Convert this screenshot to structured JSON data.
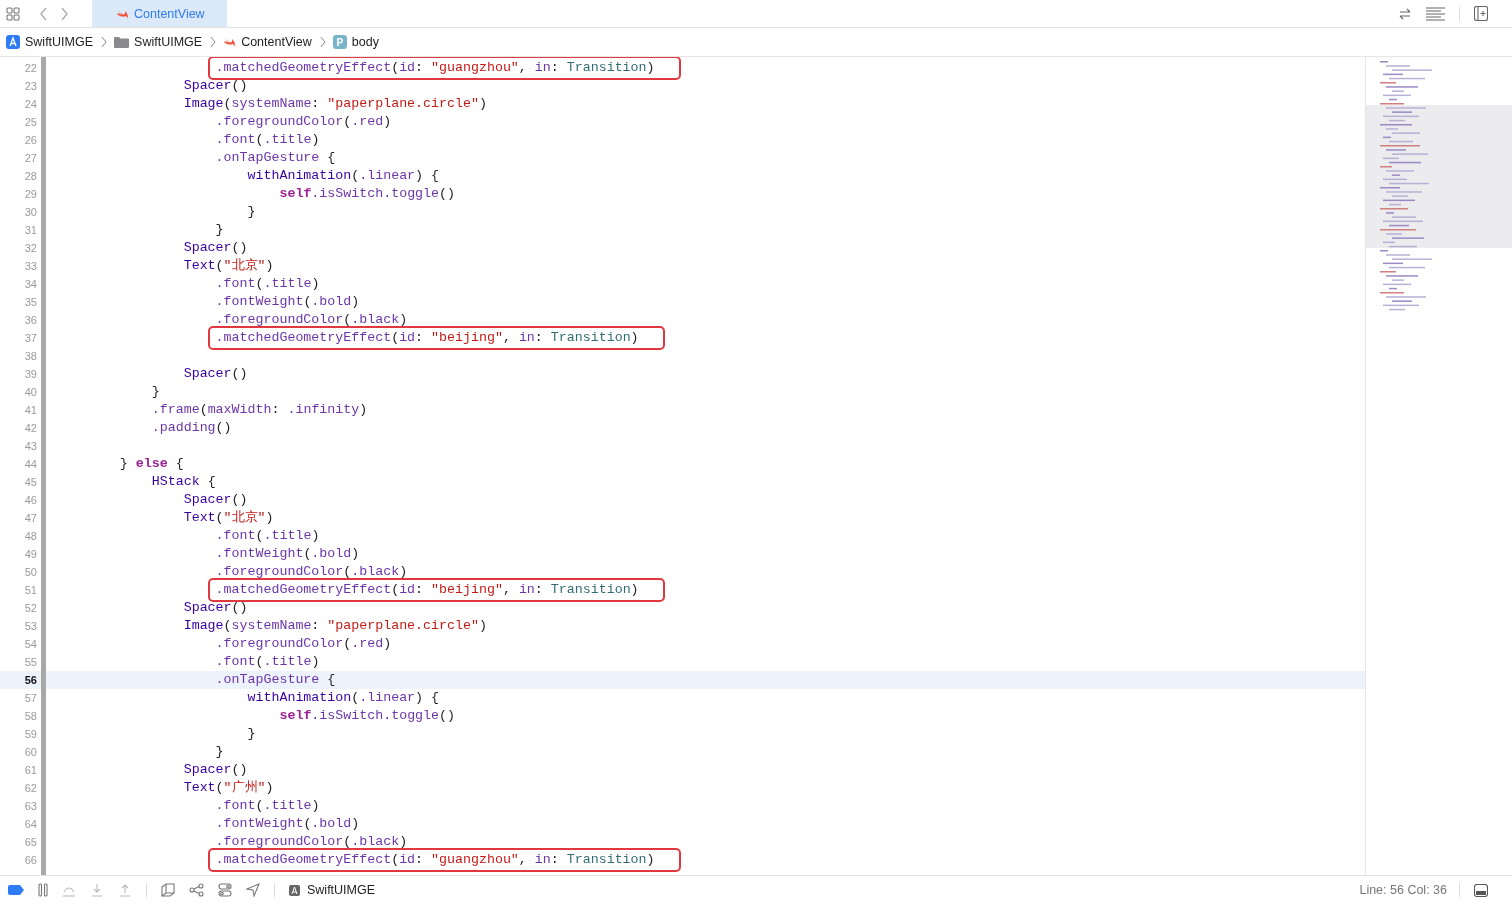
{
  "tabs": [
    {
      "label": "ContentView",
      "selected": true
    }
  ],
  "breadcrumbs": [
    {
      "kind": "app",
      "label": "SwiftUIMGE"
    },
    {
      "kind": "folder",
      "label": "SwiftUIMGE"
    },
    {
      "kind": "swift",
      "label": "ContentView"
    },
    {
      "kind": "property",
      "icon_text": "P",
      "label": "body"
    }
  ],
  "editor": {
    "lines": [
      {
        "number": "22",
        "current": false,
        "highlighted": true,
        "tokens": [
          {
            "kind": "member",
            "text": "                    .matchedGeometryEffect"
          },
          {
            "kind": "plain",
            "text": "("
          },
          {
            "kind": "member",
            "text": "id"
          },
          {
            "kind": "plain",
            "text": ": "
          },
          {
            "kind": "string",
            "text": "\"guangzhou\""
          },
          {
            "kind": "plain",
            "text": ", "
          },
          {
            "kind": "member",
            "text": "in"
          },
          {
            "kind": "plain",
            "text": ": "
          },
          {
            "kind": "project",
            "text": "Transition"
          },
          {
            "kind": "plain",
            "text": ")"
          }
        ]
      },
      {
        "number": "23",
        "current": false,
        "highlighted": false,
        "tokens": [
          {
            "kind": "type",
            "text": "                Spacer"
          },
          {
            "kind": "plain",
            "text": "()"
          }
        ]
      },
      {
        "number": "24",
        "current": false,
        "highlighted": false,
        "tokens": [
          {
            "kind": "type",
            "text": "                Image"
          },
          {
            "kind": "plain",
            "text": "("
          },
          {
            "kind": "member",
            "text": "systemName"
          },
          {
            "kind": "plain",
            "text": ": "
          },
          {
            "kind": "string",
            "text": "\"paperplane.circle\""
          },
          {
            "kind": "plain",
            "text": ")"
          }
        ]
      },
      {
        "number": "25",
        "current": false,
        "highlighted": false,
        "tokens": [
          {
            "kind": "member",
            "text": "                    .foregroundColor"
          },
          {
            "kind": "plain",
            "text": "("
          },
          {
            "kind": "member",
            "text": ".red"
          },
          {
            "kind": "plain",
            "text": ")"
          }
        ]
      },
      {
        "number": "26",
        "current": false,
        "highlighted": false,
        "tokens": [
          {
            "kind": "member",
            "text": "                    .font"
          },
          {
            "kind": "plain",
            "text": "("
          },
          {
            "kind": "member",
            "text": ".title"
          },
          {
            "kind": "plain",
            "text": ")"
          }
        ]
      },
      {
        "number": "27",
        "current": false,
        "highlighted": false,
        "tokens": [
          {
            "kind": "member",
            "text": "                    .onTapGesture"
          },
          {
            "kind": "plain",
            "text": " {"
          }
        ]
      },
      {
        "number": "28",
        "current": false,
        "highlighted": false,
        "tokens": [
          {
            "kind": "type",
            "text": "                        withAnimation"
          },
          {
            "kind": "plain",
            "text": "("
          },
          {
            "kind": "member",
            "text": ".linear"
          },
          {
            "kind": "plain",
            "text": ") {"
          }
        ]
      },
      {
        "number": "29",
        "current": false,
        "highlighted": false,
        "tokens": [
          {
            "kind": "keyword",
            "text": "                            self"
          },
          {
            "kind": "member",
            "text": ".isSwitch"
          },
          {
            "kind": "member",
            "text": ".toggle"
          },
          {
            "kind": "plain",
            "text": "()"
          }
        ]
      },
      {
        "number": "30",
        "current": false,
        "highlighted": false,
        "tokens": [
          {
            "kind": "plain",
            "text": "                        }"
          }
        ]
      },
      {
        "number": "31",
        "current": false,
        "highlighted": false,
        "tokens": [
          {
            "kind": "plain",
            "text": "                    }"
          }
        ]
      },
      {
        "number": "32",
        "current": false,
        "highlighted": false,
        "tokens": [
          {
            "kind": "type",
            "text": "                Spacer"
          },
          {
            "kind": "plain",
            "text": "()"
          }
        ]
      },
      {
        "number": "33",
        "current": false,
        "highlighted": false,
        "tokens": [
          {
            "kind": "type",
            "text": "                Text"
          },
          {
            "kind": "plain",
            "text": "("
          },
          {
            "kind": "string",
            "text": "\"北京\""
          },
          {
            "kind": "plain",
            "text": ")"
          }
        ]
      },
      {
        "number": "34",
        "current": false,
        "highlighted": false,
        "tokens": [
          {
            "kind": "member",
            "text": "                    .font"
          },
          {
            "kind": "plain",
            "text": "("
          },
          {
            "kind": "member",
            "text": ".title"
          },
          {
            "kind": "plain",
            "text": ")"
          }
        ]
      },
      {
        "number": "35",
        "current": false,
        "highlighted": false,
        "tokens": [
          {
            "kind": "member",
            "text": "                    .fontWeight"
          },
          {
            "kind": "plain",
            "text": "("
          },
          {
            "kind": "member",
            "text": ".bold"
          },
          {
            "kind": "plain",
            "text": ")"
          }
        ]
      },
      {
        "number": "36",
        "current": false,
        "highlighted": false,
        "tokens": [
          {
            "kind": "member",
            "text": "                    .foregroundColor"
          },
          {
            "kind": "plain",
            "text": "("
          },
          {
            "kind": "member",
            "text": ".black"
          },
          {
            "kind": "plain",
            "text": ")"
          }
        ]
      },
      {
        "number": "37",
        "current": false,
        "highlighted": true,
        "tokens": [
          {
            "kind": "member",
            "text": "                    .matchedGeometryEffect"
          },
          {
            "kind": "plain",
            "text": "("
          },
          {
            "kind": "member",
            "text": "id"
          },
          {
            "kind": "plain",
            "text": ": "
          },
          {
            "kind": "string",
            "text": "\"beijing\""
          },
          {
            "kind": "plain",
            "text": ", "
          },
          {
            "kind": "member",
            "text": "in"
          },
          {
            "kind": "plain",
            "text": ": "
          },
          {
            "kind": "project",
            "text": "Transition"
          },
          {
            "kind": "plain",
            "text": ")"
          }
        ]
      },
      {
        "number": "38",
        "current": false,
        "highlighted": false
      },
      {
        "number": "39",
        "current": false,
        "highlighted": false,
        "tokens": [
          {
            "kind": "type",
            "text": "                Spacer"
          },
          {
            "kind": "plain",
            "text": "()"
          }
        ]
      },
      {
        "number": "40",
        "current": false,
        "highlighted": false,
        "tokens": [
          {
            "kind": "plain",
            "text": "            }"
          }
        ]
      },
      {
        "number": "41",
        "current": false,
        "highlighted": false,
        "tokens": [
          {
            "kind": "member",
            "text": "            .frame"
          },
          {
            "kind": "plain",
            "text": "("
          },
          {
            "kind": "member",
            "text": "maxWidth"
          },
          {
            "kind": "plain",
            "text": ": "
          },
          {
            "kind": "member",
            "text": ".infinity"
          },
          {
            "kind": "plain",
            "text": ")"
          }
        ]
      },
      {
        "number": "42",
        "current": false,
        "highlighted": false,
        "tokens": [
          {
            "kind": "member",
            "text": "            .padding"
          },
          {
            "kind": "plain",
            "text": "()"
          }
        ]
      },
      {
        "number": "43",
        "current": false,
        "highlighted": false
      },
      {
        "number": "44",
        "current": false,
        "highlighted": false,
        "tokens": [
          {
            "kind": "plain",
            "text": "        } "
          },
          {
            "kind": "keyword",
            "text": "else"
          },
          {
            "kind": "plain",
            "text": " {"
          }
        ]
      },
      {
        "number": "45",
        "current": false,
        "highlighted": false,
        "tokens": [
          {
            "kind": "type",
            "text": "            HStack"
          },
          {
            "kind": "plain",
            "text": " {"
          }
        ]
      },
      {
        "number": "46",
        "current": false,
        "highlighted": false,
        "tokens": [
          {
            "kind": "type",
            "text": "                Spacer"
          },
          {
            "kind": "plain",
            "text": "()"
          }
        ]
      },
      {
        "number": "47",
        "current": false,
        "highlighted": false,
        "tokens": [
          {
            "kind": "type",
            "text": "                Text"
          },
          {
            "kind": "plain",
            "text": "("
          },
          {
            "kind": "string",
            "text": "\"北京\""
          },
          {
            "kind": "plain",
            "text": ")"
          }
        ]
      },
      {
        "number": "48",
        "current": false,
        "highlighted": false,
        "tokens": [
          {
            "kind": "member",
            "text": "                    .font"
          },
          {
            "kind": "plain",
            "text": "("
          },
          {
            "kind": "member",
            "text": ".title"
          },
          {
            "kind": "plain",
            "text": ")"
          }
        ]
      },
      {
        "number": "49",
        "current": false,
        "highlighted": false,
        "tokens": [
          {
            "kind": "member",
            "text": "                    .fontWeight"
          },
          {
            "kind": "plain",
            "text": "("
          },
          {
            "kind": "member",
            "text": ".bold"
          },
          {
            "kind": "plain",
            "text": ")"
          }
        ]
      },
      {
        "number": "50",
        "current": false,
        "highlighted": false,
        "tokens": [
          {
            "kind": "member",
            "text": "                    .foregroundColor"
          },
          {
            "kind": "plain",
            "text": "("
          },
          {
            "kind": "member",
            "text": ".black"
          },
          {
            "kind": "plain",
            "text": ")"
          }
        ]
      },
      {
        "number": "51",
        "current": false,
        "highlighted": true,
        "tokens": [
          {
            "kind": "member",
            "text": "                    .matchedGeometryEffect"
          },
          {
            "kind": "plain",
            "text": "("
          },
          {
            "kind": "member",
            "text": "id"
          },
          {
            "kind": "plain",
            "text": ": "
          },
          {
            "kind": "string",
            "text": "\"beijing\""
          },
          {
            "kind": "plain",
            "text": ", "
          },
          {
            "kind": "member",
            "text": "in"
          },
          {
            "kind": "plain",
            "text": ": "
          },
          {
            "kind": "project",
            "text": "Transition"
          },
          {
            "kind": "plain",
            "text": ")"
          }
        ]
      },
      {
        "number": "52",
        "current": false,
        "highlighted": false,
        "tokens": [
          {
            "kind": "type",
            "text": "                Spacer"
          },
          {
            "kind": "plain",
            "text": "()"
          }
        ]
      },
      {
        "number": "53",
        "current": false,
        "highlighted": false,
        "tokens": [
          {
            "kind": "type",
            "text": "                Image"
          },
          {
            "kind": "plain",
            "text": "("
          },
          {
            "kind": "member",
            "text": "systemName"
          },
          {
            "kind": "plain",
            "text": ": "
          },
          {
            "kind": "string",
            "text": "\"paperplane.circle\""
          },
          {
            "kind": "plain",
            "text": ")"
          }
        ]
      },
      {
        "number": "54",
        "current": false,
        "highlighted": false,
        "tokens": [
          {
            "kind": "member",
            "text": "                    .foregroundColor"
          },
          {
            "kind": "plain",
            "text": "("
          },
          {
            "kind": "member",
            "text": ".red"
          },
          {
            "kind": "plain",
            "text": ")"
          }
        ]
      },
      {
        "number": "55",
        "current": false,
        "highlighted": false,
        "tokens": [
          {
            "kind": "member",
            "text": "                    .font"
          },
          {
            "kind": "plain",
            "text": "("
          },
          {
            "kind": "member",
            "text": ".title"
          },
          {
            "kind": "plain",
            "text": ")"
          }
        ]
      },
      {
        "number": "56",
        "current": true,
        "highlighted": false,
        "tokens": [
          {
            "kind": "member",
            "text": "                    .onTapGesture"
          },
          {
            "kind": "plain",
            "text": " {"
          }
        ]
      },
      {
        "number": "57",
        "current": false,
        "highlighted": false,
        "tokens": [
          {
            "kind": "type",
            "text": "                        withAnimation"
          },
          {
            "kind": "plain",
            "text": "("
          },
          {
            "kind": "member",
            "text": ".linear"
          },
          {
            "kind": "plain",
            "text": ") {"
          }
        ]
      },
      {
        "number": "58",
        "current": false,
        "highlighted": false,
        "tokens": [
          {
            "kind": "keyword",
            "text": "                            self"
          },
          {
            "kind": "member",
            "text": ".isSwitch"
          },
          {
            "kind": "member",
            "text": ".toggle"
          },
          {
            "kind": "plain",
            "text": "()"
          }
        ]
      },
      {
        "number": "59",
        "current": false,
        "highlighted": false,
        "tokens": [
          {
            "kind": "plain",
            "text": "                        }"
          }
        ]
      },
      {
        "number": "60",
        "current": false,
        "highlighted": false,
        "tokens": [
          {
            "kind": "plain",
            "text": "                    }"
          }
        ]
      },
      {
        "number": "61",
        "current": false,
        "highlighted": false,
        "tokens": [
          {
            "kind": "type",
            "text": "                Spacer"
          },
          {
            "kind": "plain",
            "text": "()"
          }
        ]
      },
      {
        "number": "62",
        "current": false,
        "highlighted": false,
        "tokens": [
          {
            "kind": "type",
            "text": "                Text"
          },
          {
            "kind": "plain",
            "text": "("
          },
          {
            "kind": "string",
            "text": "\"广州\""
          },
          {
            "kind": "plain",
            "text": ")"
          }
        ]
      },
      {
        "number": "63",
        "current": false,
        "highlighted": false,
        "tokens": [
          {
            "kind": "member",
            "text": "                    .font"
          },
          {
            "kind": "plain",
            "text": "("
          },
          {
            "kind": "member",
            "text": ".title"
          },
          {
            "kind": "plain",
            "text": ")"
          }
        ]
      },
      {
        "number": "64",
        "current": false,
        "highlighted": false,
        "tokens": [
          {
            "kind": "member",
            "text": "                    .fontWeight"
          },
          {
            "kind": "plain",
            "text": "("
          },
          {
            "kind": "member",
            "text": ".bold"
          },
          {
            "kind": "plain",
            "text": ")"
          }
        ]
      },
      {
        "number": "65",
        "current": false,
        "highlighted": false,
        "tokens": [
          {
            "kind": "member",
            "text": "                    .foregroundColor"
          },
          {
            "kind": "plain",
            "text": "("
          },
          {
            "kind": "member",
            "text": ".black"
          },
          {
            "kind": "plain",
            "text": ")"
          }
        ]
      },
      {
        "number": "66",
        "current": false,
        "highlighted": true,
        "tokens": [
          {
            "kind": "member",
            "text": "                    .matchedGeometryEffect"
          },
          {
            "kind": "plain",
            "text": "("
          },
          {
            "kind": "member",
            "text": "id"
          },
          {
            "kind": "plain",
            "text": ": "
          },
          {
            "kind": "string",
            "text": "\"guangzhou\""
          },
          {
            "kind": "plain",
            "text": ", "
          },
          {
            "kind": "member",
            "text": "in"
          },
          {
            "kind": "plain",
            "text": ": "
          },
          {
            "kind": "project",
            "text": "Transition"
          },
          {
            "kind": "plain",
            "text": ")"
          }
        ]
      }
    ]
  },
  "status_bar": {
    "scheme": "SwiftUIMGE",
    "position": "Line: 56  Col: 36"
  }
}
